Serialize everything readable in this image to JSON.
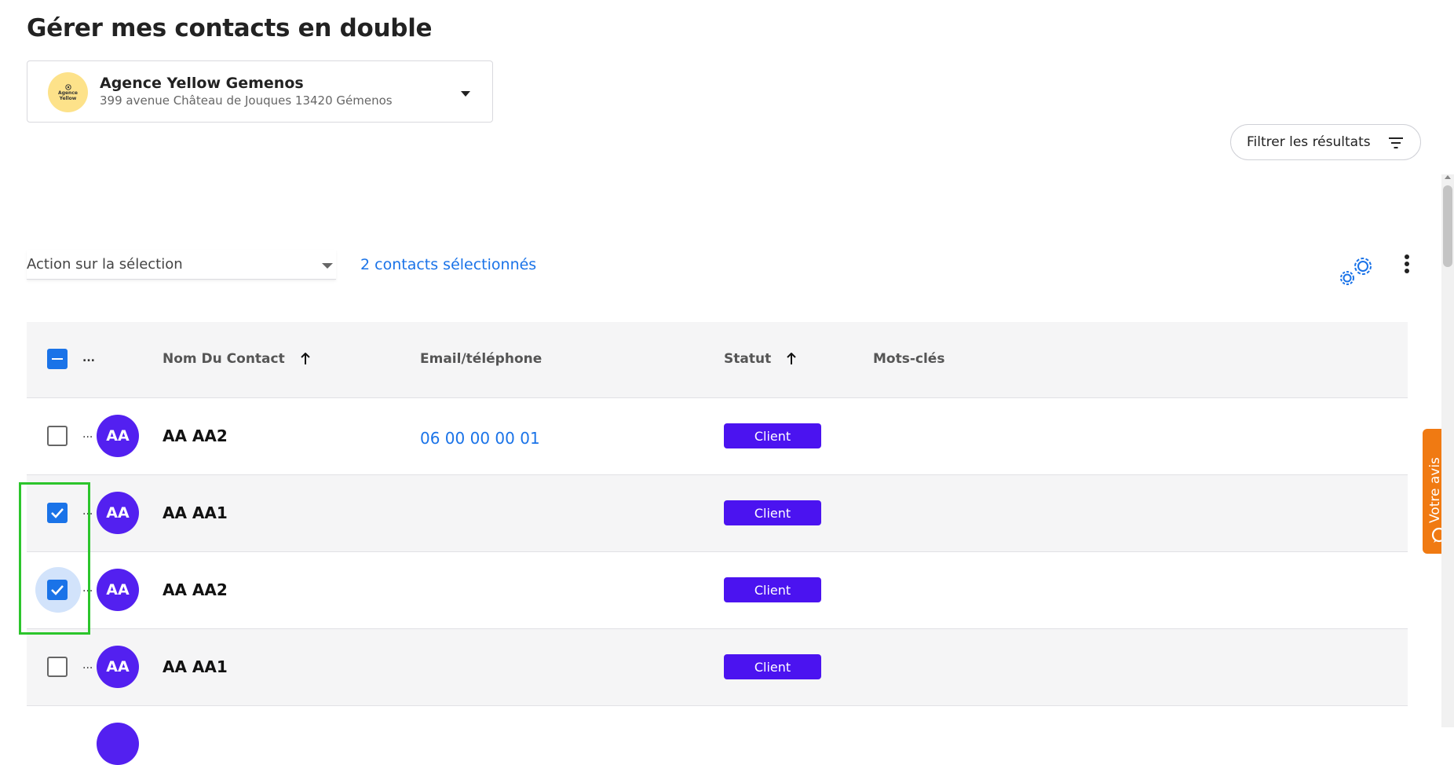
{
  "page": {
    "title": "Gérer mes contacts en double"
  },
  "agency": {
    "logo_text_line1": "Agence",
    "logo_text_line2": "Yellow",
    "name": "Agence Yellow Gemenos",
    "address": "399 avenue Château de Jouques 13420 Gémenos"
  },
  "filter": {
    "label": "Filtrer les résultats",
    "icon": "filter-icon"
  },
  "toolbar": {
    "action_select_label": "Action sur la sélection",
    "selection_count": "2 contacts sélectionnés",
    "settings_icon": "gears-icon",
    "more_icon": "more-vertical-icon"
  },
  "table": {
    "header_checkbox_state": "indeterminate",
    "headers": {
      "menu": "...",
      "name": "Nom Du Contact",
      "contact": "Email/téléphone",
      "status": "Statut",
      "keywords": "Mots-clés"
    },
    "sort": {
      "name": "ascending",
      "status": "ascending"
    },
    "rows": [
      {
        "menu": "...",
        "initials": "AA",
        "name": "AA AA2",
        "contact": "06 00 00 00 01",
        "status": "Client",
        "checked": false
      },
      {
        "menu": "...",
        "initials": "AA",
        "name": "AA AA1",
        "contact": "",
        "status": "Client",
        "checked": true
      },
      {
        "menu": "...",
        "initials": "AA",
        "name": "AA AA2",
        "contact": "",
        "status": "Client",
        "checked": true
      },
      {
        "menu": "...",
        "initials": "AA",
        "name": "AA AA1",
        "contact": "",
        "status": "Client",
        "checked": false
      }
    ]
  },
  "feedback": {
    "label": "Votre avis",
    "icon": "chat-bubble-icon"
  },
  "colors": {
    "accent_blue": "#1a73e8",
    "status_badge": "#4b13f0",
    "avatar": "#5320f0",
    "feedback_orange": "#f07a12",
    "highlight_green": "#2cc52c"
  }
}
